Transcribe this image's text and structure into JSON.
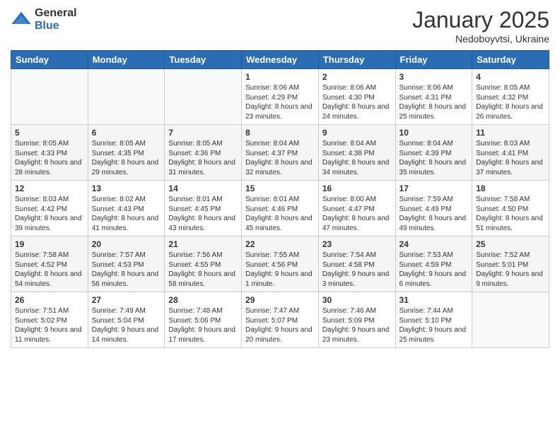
{
  "logo": {
    "general": "General",
    "blue": "Blue"
  },
  "header": {
    "month": "January 2025",
    "location": "Nedoboyvtsi, Ukraine"
  },
  "weekdays": [
    "Sunday",
    "Monday",
    "Tuesday",
    "Wednesday",
    "Thursday",
    "Friday",
    "Saturday"
  ],
  "weeks": [
    [
      {
        "day": "",
        "info": ""
      },
      {
        "day": "",
        "info": ""
      },
      {
        "day": "",
        "info": ""
      },
      {
        "day": "1",
        "info": "Sunrise: 8:06 AM\nSunset: 4:29 PM\nDaylight: 8 hours and 23 minutes."
      },
      {
        "day": "2",
        "info": "Sunrise: 8:06 AM\nSunset: 4:30 PM\nDaylight: 8 hours and 24 minutes."
      },
      {
        "day": "3",
        "info": "Sunrise: 8:06 AM\nSunset: 4:31 PM\nDaylight: 8 hours and 25 minutes."
      },
      {
        "day": "4",
        "info": "Sunrise: 8:05 AM\nSunset: 4:32 PM\nDaylight: 8 hours and 26 minutes."
      }
    ],
    [
      {
        "day": "5",
        "info": "Sunrise: 8:05 AM\nSunset: 4:33 PM\nDaylight: 8 hours and 28 minutes."
      },
      {
        "day": "6",
        "info": "Sunrise: 8:05 AM\nSunset: 4:35 PM\nDaylight: 8 hours and 29 minutes."
      },
      {
        "day": "7",
        "info": "Sunrise: 8:05 AM\nSunset: 4:36 PM\nDaylight: 8 hours and 31 minutes."
      },
      {
        "day": "8",
        "info": "Sunrise: 8:04 AM\nSunset: 4:37 PM\nDaylight: 8 hours and 32 minutes."
      },
      {
        "day": "9",
        "info": "Sunrise: 8:04 AM\nSunset: 4:38 PM\nDaylight: 8 hours and 34 minutes."
      },
      {
        "day": "10",
        "info": "Sunrise: 8:04 AM\nSunset: 4:39 PM\nDaylight: 8 hours and 35 minutes."
      },
      {
        "day": "11",
        "info": "Sunrise: 8:03 AM\nSunset: 4:41 PM\nDaylight: 8 hours and 37 minutes."
      }
    ],
    [
      {
        "day": "12",
        "info": "Sunrise: 8:03 AM\nSunset: 4:42 PM\nDaylight: 8 hours and 39 minutes."
      },
      {
        "day": "13",
        "info": "Sunrise: 8:02 AM\nSunset: 4:43 PM\nDaylight: 8 hours and 41 minutes."
      },
      {
        "day": "14",
        "info": "Sunrise: 8:01 AM\nSunset: 4:45 PM\nDaylight: 8 hours and 43 minutes."
      },
      {
        "day": "15",
        "info": "Sunrise: 8:01 AM\nSunset: 4:46 PM\nDaylight: 8 hours and 45 minutes."
      },
      {
        "day": "16",
        "info": "Sunrise: 8:00 AM\nSunset: 4:47 PM\nDaylight: 8 hours and 47 minutes."
      },
      {
        "day": "17",
        "info": "Sunrise: 7:59 AM\nSunset: 4:49 PM\nDaylight: 8 hours and 49 minutes."
      },
      {
        "day": "18",
        "info": "Sunrise: 7:58 AM\nSunset: 4:50 PM\nDaylight: 8 hours and 51 minutes."
      }
    ],
    [
      {
        "day": "19",
        "info": "Sunrise: 7:58 AM\nSunset: 4:52 PM\nDaylight: 8 hours and 54 minutes."
      },
      {
        "day": "20",
        "info": "Sunrise: 7:57 AM\nSunset: 4:53 PM\nDaylight: 8 hours and 56 minutes."
      },
      {
        "day": "21",
        "info": "Sunrise: 7:56 AM\nSunset: 4:55 PM\nDaylight: 8 hours and 58 minutes."
      },
      {
        "day": "22",
        "info": "Sunrise: 7:55 AM\nSunset: 4:56 PM\nDaylight: 9 hours and 1 minute."
      },
      {
        "day": "23",
        "info": "Sunrise: 7:54 AM\nSunset: 4:58 PM\nDaylight: 9 hours and 3 minutes."
      },
      {
        "day": "24",
        "info": "Sunrise: 7:53 AM\nSunset: 4:59 PM\nDaylight: 9 hours and 6 minutes."
      },
      {
        "day": "25",
        "info": "Sunrise: 7:52 AM\nSunset: 5:01 PM\nDaylight: 9 hours and 9 minutes."
      }
    ],
    [
      {
        "day": "26",
        "info": "Sunrise: 7:51 AM\nSunset: 5:02 PM\nDaylight: 9 hours and 11 minutes."
      },
      {
        "day": "27",
        "info": "Sunrise: 7:49 AM\nSunset: 5:04 PM\nDaylight: 9 hours and 14 minutes."
      },
      {
        "day": "28",
        "info": "Sunrise: 7:48 AM\nSunset: 5:06 PM\nDaylight: 9 hours and 17 minutes."
      },
      {
        "day": "29",
        "info": "Sunrise: 7:47 AM\nSunset: 5:07 PM\nDaylight: 9 hours and 20 minutes."
      },
      {
        "day": "30",
        "info": "Sunrise: 7:46 AM\nSunset: 5:09 PM\nDaylight: 9 hours and 23 minutes."
      },
      {
        "day": "31",
        "info": "Sunrise: 7:44 AM\nSunset: 5:10 PM\nDaylight: 9 hours and 25 minutes."
      },
      {
        "day": "",
        "info": ""
      }
    ]
  ]
}
